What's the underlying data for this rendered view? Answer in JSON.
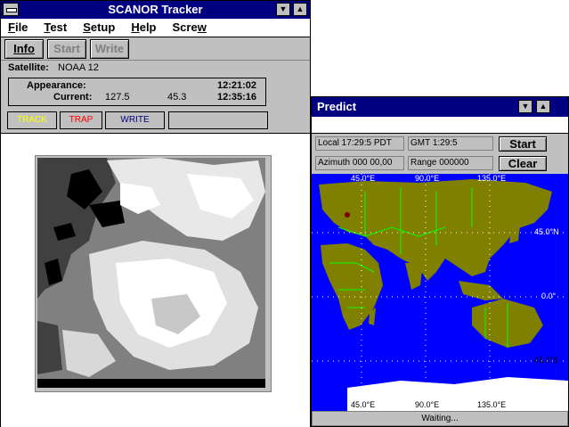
{
  "tracker": {
    "title": "SCANOR Tracker",
    "menu": [
      "File",
      "Test",
      "Setup",
      "Help",
      "Screw"
    ],
    "buttons": {
      "info": "Info",
      "start": "Start",
      "write": "Write"
    },
    "satellite_label": "Satellite:",
    "satellite_value": "NOAA 12",
    "appearance_label": "Appearance:",
    "appearance_time": "12:21:02",
    "current_label": "Current:",
    "current_az": "127.5",
    "current_el": "45.3",
    "current_time": "12:35:16",
    "modes": {
      "track": "TRACK",
      "trap": "TRAP",
      "write": "WRITE",
      "blank": ""
    },
    "colors": {
      "track": "#ffff00",
      "trap": "#ff0000",
      "write": "#000080"
    }
  },
  "predict": {
    "title": "Predict",
    "local": "Local 17:29:5 PDT",
    "gmt": "GMT 1:29:5",
    "azimuth": "Azimuth 000 00,00",
    "range": "Range 000000",
    "start_label": "Start",
    "clear_label": "Clear",
    "lon_top": [
      "45.0°E",
      "90.0°E",
      "135.0°E"
    ],
    "lon_bottom": [
      "45.0°E",
      "90.0°E",
      "135.0°E"
    ],
    "lat_labels": [
      "45.0°N",
      "0.0°",
      "45.0°S"
    ],
    "status": "Waiting...",
    "colors": {
      "ocean": "#0000ff",
      "land": "#808000",
      "borders": "#00ff00",
      "ice": "#ffffff"
    }
  }
}
